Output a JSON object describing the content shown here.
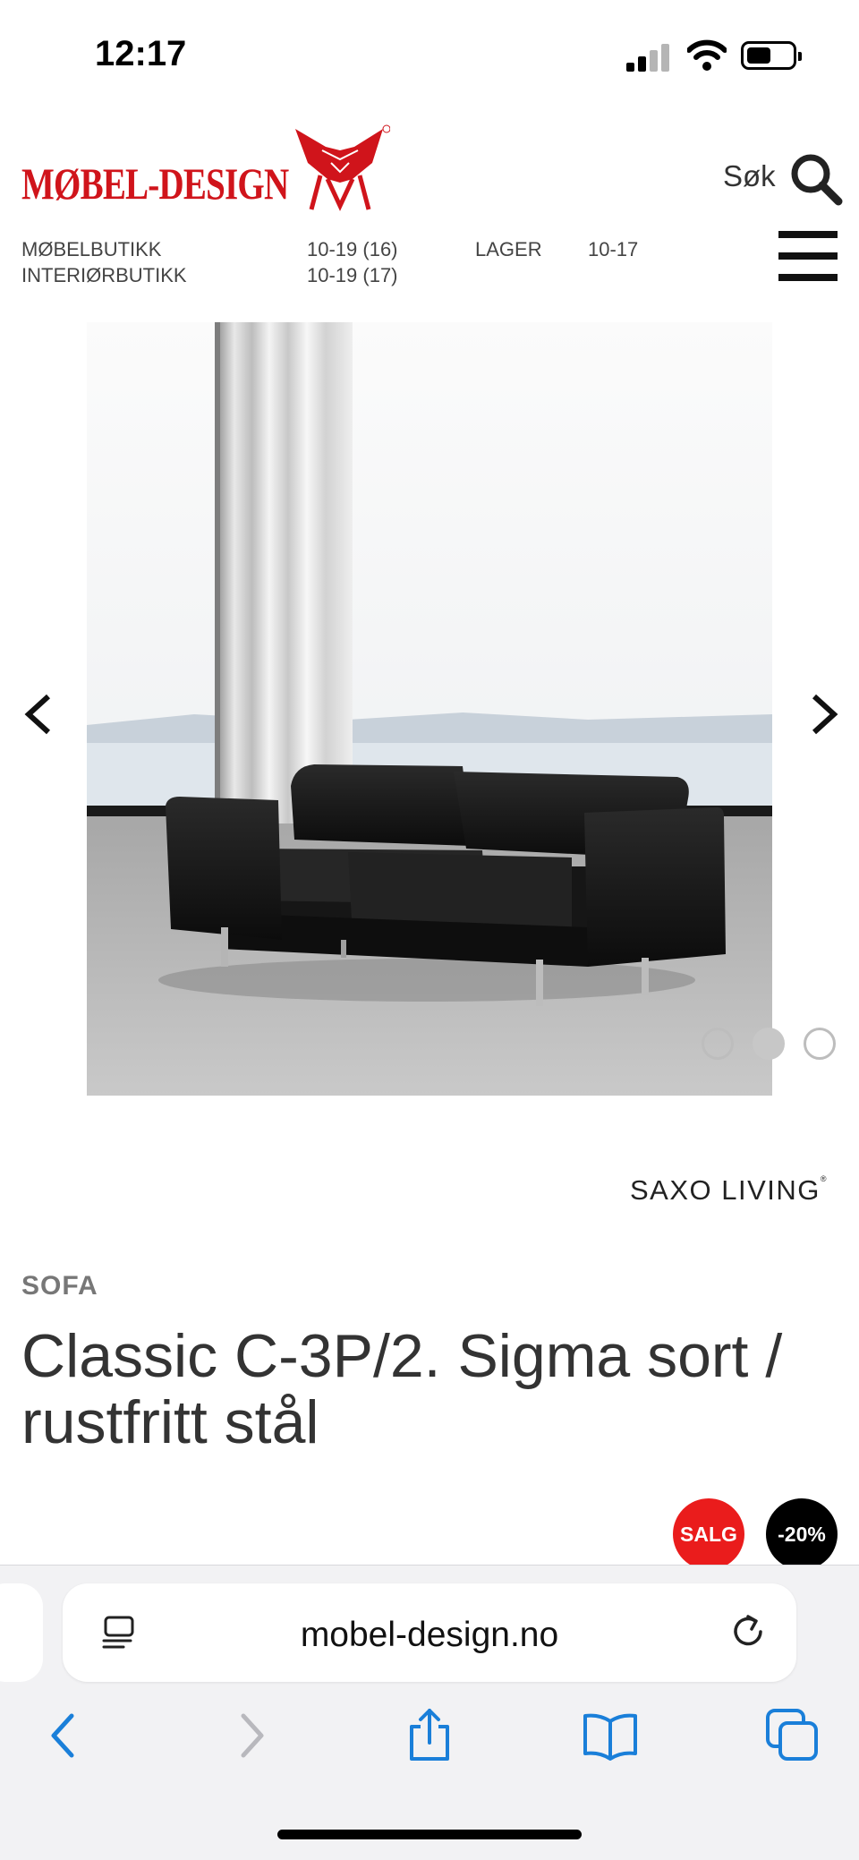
{
  "status_bar": {
    "time": "12:17"
  },
  "header": {
    "logo_text": "MØBEL-DESIGN",
    "search_label": "Søk"
  },
  "opening_hours": [
    {
      "name": "MØBELBUTIKK",
      "hours": "10-19 (16)"
    },
    {
      "name": "INTERIØRBUTIKK",
      "hours": "10-19 (17)"
    },
    {
      "name": "LAGER",
      "hours": "10-17"
    }
  ],
  "gallery": {
    "image_count": 3,
    "active_index": 1
  },
  "product": {
    "brand": "SAXO LIVING",
    "brand_mark": "®",
    "category": "SOFA",
    "title": "Classic C-3P/2. Sigma sort / rustfritt stål",
    "badges": {
      "sale": "SALG",
      "discount": "-20%"
    }
  },
  "browser": {
    "url": "mobel-design.no"
  },
  "colors": {
    "brand_red": "#d0141b",
    "sale_badge": "#ea1c1c",
    "discount_badge": "#000000",
    "ios_blue": "#1a7fd9",
    "disabled": "#b8b8bd"
  }
}
